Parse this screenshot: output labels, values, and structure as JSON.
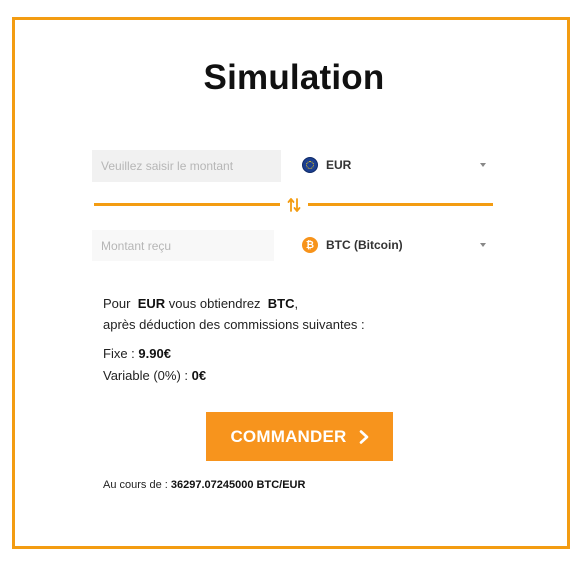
{
  "title": "Simulation",
  "from": {
    "amount_placeholder": "Veuillez saisir le montant",
    "currency_label": "EUR",
    "currency_icon": "euro-flag-icon"
  },
  "to": {
    "amount_placeholder": "Montant reçu",
    "currency_label": "BTC (Bitcoin)",
    "currency_icon": "bitcoin-icon"
  },
  "summary": {
    "prefix": "Pour",
    "from_currency": "EUR",
    "middle": "vous obtiendrez",
    "to_currency": "BTC",
    "suffix": ",",
    "line2": "après déduction des commissions suivantes :",
    "fixed_label": "Fixe :",
    "fixed_value": "9.90€",
    "variable_label": "Variable (0%) :",
    "variable_value": "0€"
  },
  "order_button_label": "COMMANDER",
  "rate": {
    "label": "Au cours de :",
    "value": "36297.07245000 BTC/EUR"
  },
  "colors": {
    "accent": "#f39c12",
    "button": "#f7941d",
    "euro_flag": "#1b3e8f",
    "bitcoin": "#f7931a"
  }
}
